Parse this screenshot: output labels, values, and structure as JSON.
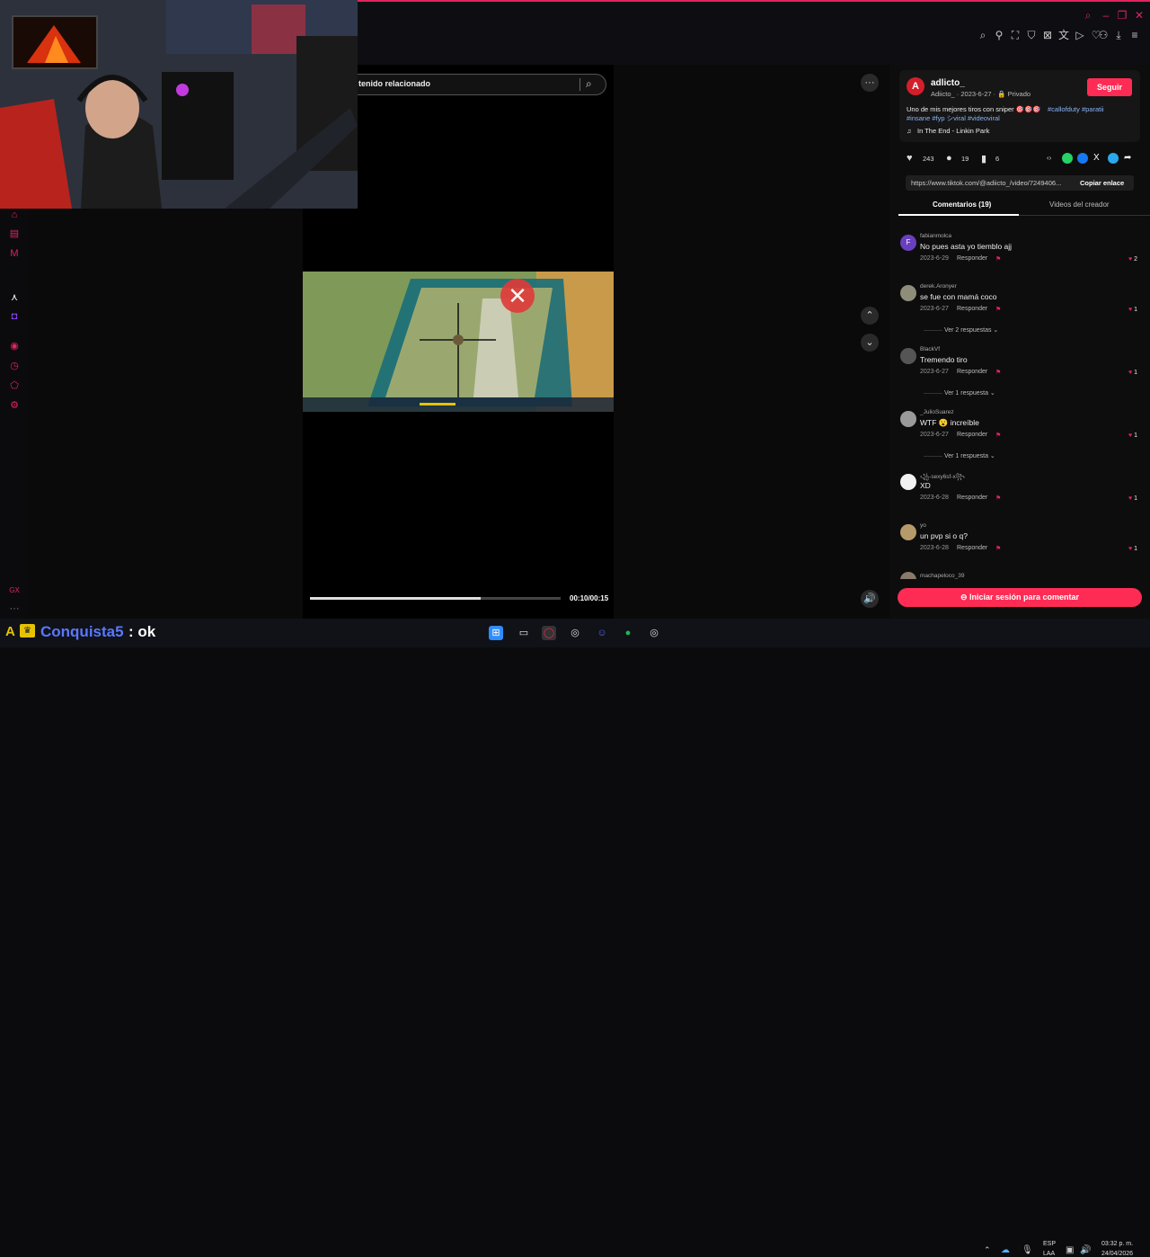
{
  "search": {
    "text": "tenido relacionado"
  },
  "video": {
    "time": "00:10/00:15",
    "progress": 0.68
  },
  "author": {
    "name": "adlicto_",
    "meta": "Adiicto_ · 2023-6-27 · 🔒 Privado",
    "follow_label": "Seguir",
    "avatar_letter": "A"
  },
  "caption": {
    "text": "Uno de mis mejores tiros con sniper 🎯🎯🎯",
    "tags1": "#callofduty #paratii",
    "tags2": "#insane #fyp シviral #videoviral"
  },
  "music": {
    "text": "In The End - Linkin Park"
  },
  "stats": {
    "likes": "243",
    "comments": "19",
    "saves": "6"
  },
  "link": {
    "url": "https://www.tiktok.com/@adiicto_/video/7249406...",
    "copy_label": "Copiar enlace"
  },
  "tabs": {
    "comments": "Comentarios (19)",
    "creator": "Videos del creador"
  },
  "comments": [
    {
      "user": "fabianmolca",
      "text": "No pues asta yo tiemblo ajj",
      "date": "2023-6-29",
      "reply": "Responder",
      "likes": "2",
      "more": "",
      "avatar_letter": "F"
    },
    {
      "user": "derek.Aronyer",
      "text": "se fue con mamá coco",
      "date": "2023-6-27",
      "reply": "Responder",
      "likes": "1",
      "more": "Ver 2 respuestas ⌄",
      "avatar_letter": ""
    },
    {
      "user": "BlackVf",
      "text": "Tremendo tiro",
      "date": "2023-6-27",
      "reply": "Responder",
      "likes": "1",
      "more": "Ver 1 respuesta ⌄",
      "avatar_letter": ""
    },
    {
      "user": "_JulioSuarez",
      "text": "WTF 😮 increíble",
      "date": "2023-6-27",
      "reply": "Responder",
      "likes": "1",
      "more": "Ver 1 respuesta ⌄",
      "avatar_letter": ""
    },
    {
      "user": "꧁-sexy6sf-x꧂",
      "text": "XD",
      "date": "2023-6-28",
      "reply": "Responder",
      "likes": "1",
      "more": "",
      "avatar_letter": ""
    },
    {
      "user": "yo",
      "text": "un pvp si o q?",
      "date": "2023-6-28",
      "reply": "Responder",
      "likes": "1",
      "more": "",
      "avatar_letter": ""
    }
  ],
  "partial_user": "machapeloco_39",
  "login": {
    "label": "⊖ Iniciar sesión para comentar"
  },
  "chat": {
    "user": "Conquista5",
    "message": ": ok"
  },
  "taskbar": {
    "lang1": "ESP",
    "lang2": "LAA",
    "time": "03:32 p. m.",
    "date": "24/04/2026"
  },
  "colors": {
    "accent": "#fe2c55",
    "operagx": "#e0245e",
    "chat_user": "#5a78ff"
  }
}
